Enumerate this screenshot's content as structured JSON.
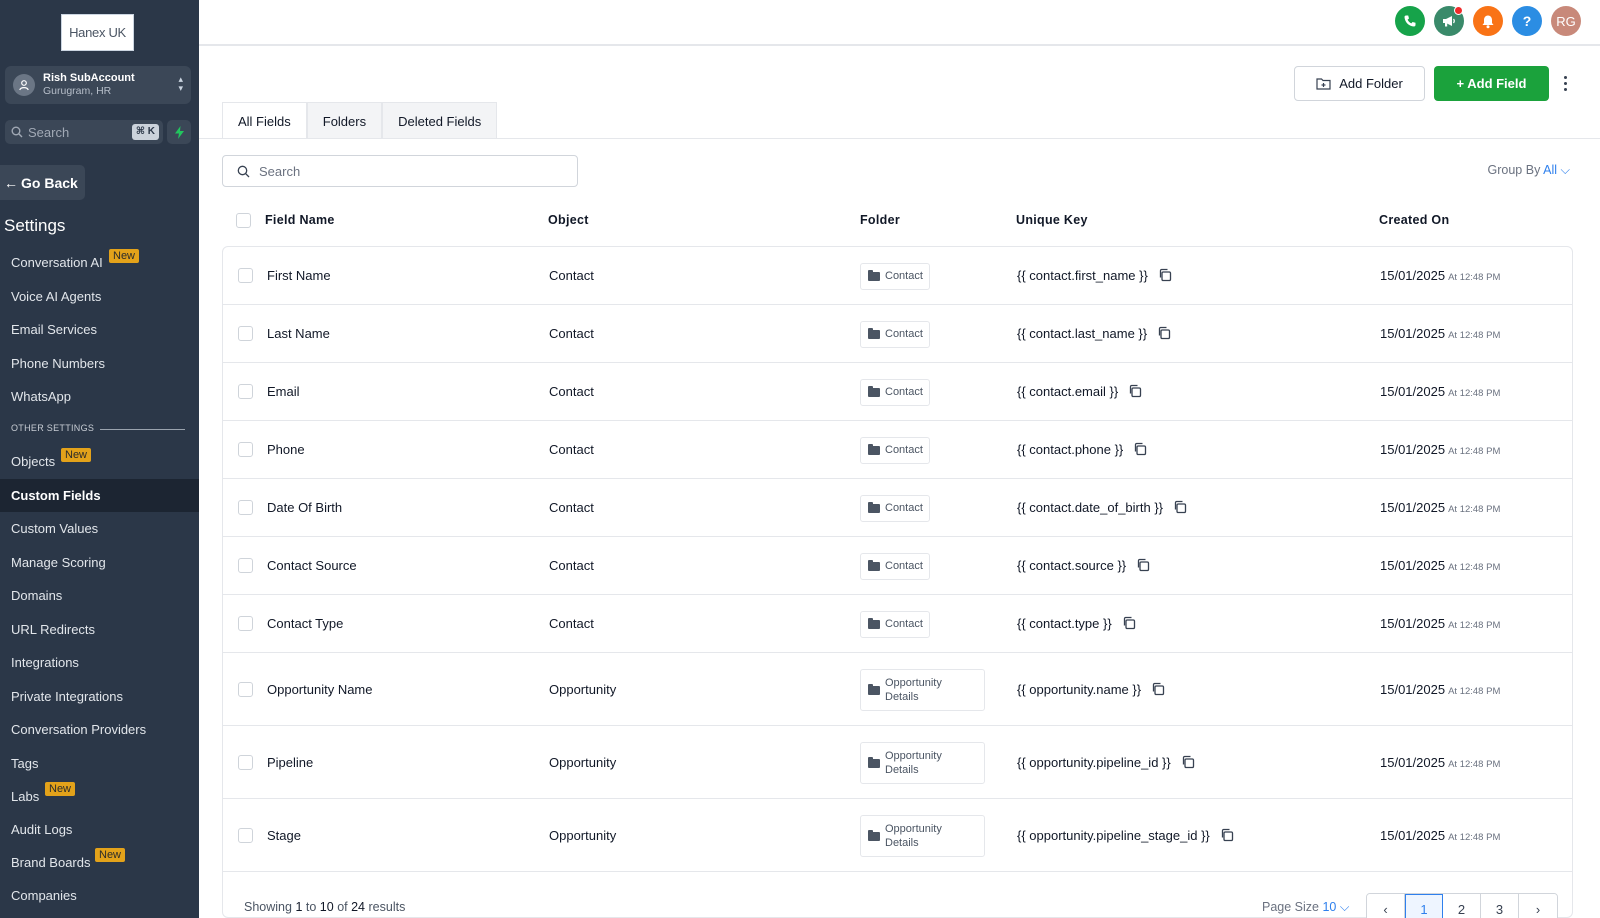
{
  "sidebar": {
    "logo_text": "Hanex UK",
    "account": {
      "name": "Rish SubAccount",
      "location": "Gurugram, HR"
    },
    "search": {
      "placeholder": "Search",
      "shortcut": "⌘ K"
    },
    "go_back": "Go Back",
    "settings_title": "Settings",
    "badge_new": "New",
    "other_settings_label": "OTHER SETTINGS",
    "items": [
      {
        "label": "Conversation AI"
      },
      {
        "label": "Voice AI Agents"
      },
      {
        "label": "Email Services"
      },
      {
        "label": "Phone Numbers"
      },
      {
        "label": "WhatsApp"
      },
      {
        "label": "Objects"
      },
      {
        "label": "Custom Fields"
      },
      {
        "label": "Custom Values"
      },
      {
        "label": "Manage Scoring"
      },
      {
        "label": "Domains"
      },
      {
        "label": "URL Redirects"
      },
      {
        "label": "Integrations"
      },
      {
        "label": "Private Integrations"
      },
      {
        "label": "Conversation Providers"
      },
      {
        "label": "Tags"
      },
      {
        "label": "Labs"
      },
      {
        "label": "Audit Logs"
      },
      {
        "label": "Brand Boards"
      },
      {
        "label": "Companies"
      }
    ]
  },
  "topbar": {
    "avatar_initials": "RG",
    "help_label": "?",
    "colors": {
      "phone": "#16a34a",
      "announce": "#3a8a6a",
      "bell": "#f97316",
      "help": "#2b8de3",
      "avatar": "#c8897a"
    }
  },
  "actions": {
    "add_folder": "Add Folder",
    "add_field": "+ Add Field"
  },
  "tabs": [
    "All Fields",
    "Folders",
    "Deleted Fields"
  ],
  "search": {
    "placeholder": "Search"
  },
  "group_by": {
    "label": "Group By",
    "value": "All"
  },
  "table": {
    "columns": [
      "Field Name",
      "Object",
      "Folder",
      "Unique Key",
      "Created On"
    ],
    "rows": [
      {
        "name": "First Name",
        "object": "Contact",
        "folder": "Contact",
        "key": "{{ contact.first_name }}",
        "date": "15/01/2025",
        "time": "At 12:48 PM"
      },
      {
        "name": "Last Name",
        "object": "Contact",
        "folder": "Contact",
        "key": "{{ contact.last_name }}",
        "date": "15/01/2025",
        "time": "At 12:48 PM"
      },
      {
        "name": "Email",
        "object": "Contact",
        "folder": "Contact",
        "key": "{{ contact.email }}",
        "date": "15/01/2025",
        "time": "At 12:48 PM"
      },
      {
        "name": "Phone",
        "object": "Contact",
        "folder": "Contact",
        "key": "{{ contact.phone }}",
        "date": "15/01/2025",
        "time": "At 12:48 PM"
      },
      {
        "name": "Date Of Birth",
        "object": "Contact",
        "folder": "Contact",
        "key": "{{ contact.date_of_birth }}",
        "date": "15/01/2025",
        "time": "At 12:48 PM"
      },
      {
        "name": "Contact Source",
        "object": "Contact",
        "folder": "Contact",
        "key": "{{ contact.source }}",
        "date": "15/01/2025",
        "time": "At 12:48 PM"
      },
      {
        "name": "Contact Type",
        "object": "Contact",
        "folder": "Contact",
        "key": "{{ contact.type }}",
        "date": "15/01/2025",
        "time": "At 12:48 PM"
      },
      {
        "name": "Opportunity Name",
        "object": "Opportunity",
        "folder": "Opportunity Details",
        "key": "{{ opportunity.name }}",
        "date": "15/01/2025",
        "time": "At 12:48 PM"
      },
      {
        "name": "Pipeline",
        "object": "Opportunity",
        "folder": "Opportunity Details",
        "key": "{{ opportunity.pipeline_id }}",
        "date": "15/01/2025",
        "time": "At 12:48 PM"
      },
      {
        "name": "Stage",
        "object": "Opportunity",
        "folder": "Opportunity Details",
        "key": "{{ opportunity.pipeline_stage_id }}",
        "date": "15/01/2025",
        "time": "At 12:48 PM"
      }
    ]
  },
  "footer": {
    "showing_prefix": "Showing",
    "from": "1",
    "to_word": "to",
    "to": "10",
    "of_word": "of",
    "total": "24",
    "results_word": "results",
    "page_size_label": "Page Size",
    "page_size": "10",
    "pages": [
      "1",
      "2",
      "3"
    ]
  }
}
